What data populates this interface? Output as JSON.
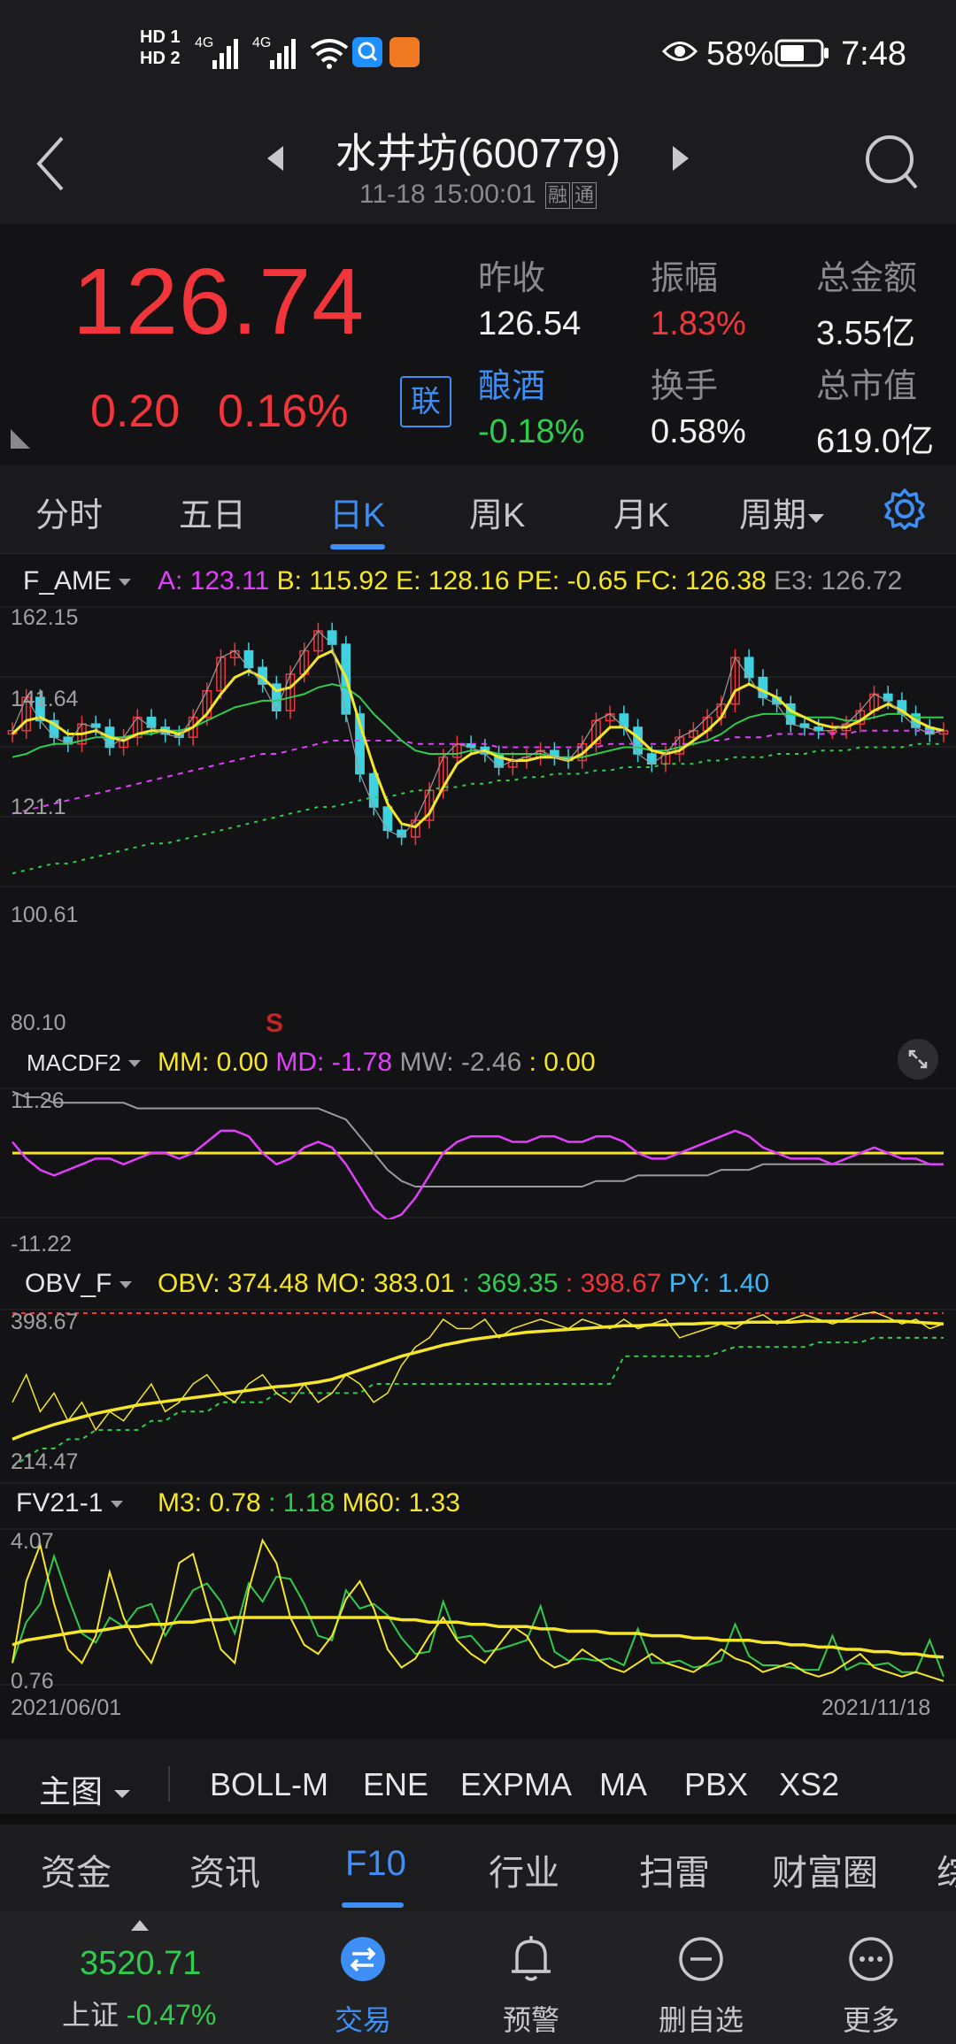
{
  "status_bar": {
    "time": "7:48",
    "battery": "58%",
    "sim1": "HD 1",
    "sim2": "HD 2",
    "net1": "4G",
    "net2": "4G"
  },
  "header": {
    "title": "水井坊(600779)",
    "timestamp": "11-18 15:00:01",
    "badge1": "融",
    "badge2": "通"
  },
  "quote": {
    "price": "126.74",
    "change": "0.20",
    "change_pct": "0.16%",
    "link_badge": "联",
    "fields": [
      {
        "label": "昨收",
        "value": "126.54",
        "color": "#f2f2f2"
      },
      {
        "label": "振幅",
        "value": "1.83%",
        "color": "#f2353a"
      },
      {
        "label": "总金额",
        "value": "3.55亿",
        "color": "#f2f2f2"
      },
      {
        "label": "酿酒",
        "value": "-0.18%",
        "color": "#2fcc4d"
      },
      {
        "label": "换手",
        "value": "0.58%",
        "color": "#f2f2f2"
      },
      {
        "label": "总市值",
        "value": "619.0亿",
        "color": "#f2f2f2"
      }
    ]
  },
  "tabs": {
    "items": [
      "分时",
      "五日",
      "日K",
      "周K",
      "月K",
      "周期"
    ],
    "active": "日K"
  },
  "chart_data": [
    {
      "type": "line",
      "name": "F_AME",
      "legend": [
        "A: 123.11",
        "B: 115.92",
        "E: 128.16",
        "PE: -0.65",
        "FC: 126.38",
        "E3: 126.72"
      ],
      "legend_colors": [
        "#e040fb",
        "#f5e62a",
        "#f5e62a",
        "#f5e62a",
        "#f5e62a",
        "#9a9a9a"
      ],
      "y_ticks": [
        "162.15",
        "141.64",
        "121.1",
        "100.61",
        "80.10"
      ],
      "ylim": [
        80.1,
        162.15
      ],
      "marker": "S",
      "closes": [
        126,
        136,
        129,
        124,
        122,
        128,
        127,
        121,
        124,
        130,
        127,
        125,
        124,
        130,
        138,
        148,
        150,
        145,
        140,
        132,
        143,
        150,
        156,
        152,
        131,
        113,
        103,
        96,
        94,
        99,
        108,
        118,
        122,
        121,
        119,
        115,
        117,
        118,
        120,
        118,
        117,
        122,
        129,
        131,
        127,
        119,
        116,
        119,
        124,
        126,
        130,
        134,
        148,
        142,
        136,
        134,
        128,
        127,
        126,
        126,
        128,
        132,
        137,
        135,
        131,
        127,
        125,
        126
      ],
      "ma_short": [
        125,
        129,
        130,
        128,
        125,
        125,
        126,
        124,
        123,
        125,
        126,
        126,
        125,
        127,
        131,
        137,
        142,
        144,
        142,
        138,
        139,
        143,
        148,
        150,
        142,
        128,
        115,
        104,
        98,
        97,
        101,
        109,
        116,
        119,
        120,
        118,
        117,
        117,
        118,
        118,
        117,
        119,
        123,
        127,
        127,
        124,
        120,
        119,
        120,
        123,
        126,
        130,
        138,
        140,
        138,
        136,
        132,
        130,
        128,
        127,
        127,
        129,
        132,
        134,
        132,
        129,
        127,
        126
      ],
      "ma_mid": [
        118,
        119,
        121,
        122,
        122,
        123,
        124,
        124,
        124,
        125,
        125,
        126,
        126,
        127,
        129,
        131,
        133,
        134,
        135,
        135,
        136,
        137,
        139,
        140,
        139,
        136,
        131,
        127,
        123,
        120,
        119,
        119,
        119,
        120,
        120,
        119,
        119,
        119,
        119,
        118,
        118,
        118,
        119,
        120,
        121,
        121,
        120,
        120,
        121,
        122,
        123,
        125,
        128,
        130,
        131,
        131,
        131,
        130,
        130,
        130,
        129,
        129,
        130,
        131,
        131,
        130,
        130,
        130
      ],
      "ma_long1": [
        101,
        102,
        103,
        104,
        105,
        106,
        107,
        108,
        109,
        110,
        111,
        112,
        113,
        114,
        115,
        116,
        117,
        118,
        119,
        119,
        120,
        121,
        122,
        123,
        123,
        123,
        123,
        123,
        123,
        122,
        122,
        122,
        122,
        122,
        122,
        121,
        121,
        121,
        121,
        121,
        121,
        121,
        121,
        122,
        122,
        122,
        122,
        122,
        122,
        122,
        123,
        123,
        124,
        124,
        124,
        125,
        125,
        125,
        125,
        125,
        125,
        126,
        126,
        126,
        126,
        126,
        126,
        126
      ],
      "ma_long2": [
        83,
        84,
        85,
        86,
        86,
        87,
        88,
        89,
        90,
        91,
        92,
        92,
        93,
        94,
        95,
        96,
        97,
        98,
        99,
        100,
        101,
        102,
        103,
        103,
        104,
        105,
        106,
        106,
        107,
        108,
        108,
        109,
        109,
        110,
        110,
        111,
        111,
        112,
        112,
        113,
        113,
        113,
        114,
        114,
        115,
        115,
        115,
        116,
        116,
        116,
        117,
        117,
        118,
        118,
        118,
        119,
        119,
        119,
        120,
        120,
        120,
        121,
        121,
        121,
        121,
        122,
        122,
        122
      ]
    },
    {
      "type": "line",
      "name": "MACDF2",
      "legend": [
        "MM: 0.00",
        "MD: -1.78",
        "MW: -2.46",
        ": 0.00"
      ],
      "legend_colors": [
        "#f5e62a",
        "#e040fb",
        "#9a9a9a",
        "#f5e62a"
      ],
      "y_ticks": [
        "11.26",
        "-11.22"
      ],
      "ylim": [
        -11.22,
        11.26
      ],
      "mm": 0.0,
      "md": [
        2,
        -1,
        -3,
        -4,
        -3,
        -2,
        -1,
        -1,
        -2,
        -1,
        0,
        0,
        -1,
        0,
        2,
        4,
        4,
        3,
        0,
        -2,
        -1,
        1,
        2,
        1,
        -2,
        -6,
        -10,
        -12,
        -11,
        -8,
        -4,
        0,
        2,
        3,
        3,
        3,
        2,
        2,
        3,
        3,
        2,
        2,
        3,
        3,
        2,
        0,
        -1,
        -1,
        0,
        1,
        2,
        3,
        4,
        3,
        1,
        0,
        -1,
        -1,
        -1,
        -2,
        -1,
        0,
        1,
        0,
        -1,
        -1,
        -2,
        -2
      ],
      "mw": [
        11,
        10,
        10,
        9,
        9,
        9,
        9,
        9,
        9,
        8,
        8,
        8,
        8,
        8,
        8,
        8,
        8,
        8,
        8,
        8,
        8,
        8,
        8,
        7,
        6,
        3,
        0,
        -3,
        -5,
        -6,
        -6,
        -6,
        -6,
        -6,
        -6,
        -6,
        -6,
        -6,
        -6,
        -6,
        -6,
        -6,
        -5,
        -5,
        -5,
        -4,
        -4,
        -4,
        -4,
        -4,
        -4,
        -3,
        -3,
        -3,
        -2,
        -2,
        -2,
        -2,
        -2,
        -2,
        -2,
        -2,
        -2,
        -2,
        -2,
        -2,
        -2,
        -2
      ]
    },
    {
      "type": "line",
      "name": "OBV_F",
      "legend": [
        "OBV: 374.48",
        "MO: 383.01",
        ": 369.35",
        ": 398.67",
        "PY: 1.40"
      ],
      "legend_colors": [
        "#f5e62a",
        "#f5e62a",
        "#2fcc4d",
        "#f2353a",
        "#3fb6f5"
      ],
      "y_ticks": [
        "398.67",
        "214.47"
      ],
      "ylim": [
        214.47,
        398.67
      ],
      "obv": [
        300,
        330,
        290,
        310,
        280,
        300,
        270,
        290,
        280,
        300,
        320,
        290,
        300,
        320,
        330,
        310,
        300,
        320,
        330,
        310,
        300,
        320,
        300,
        310,
        330,
        320,
        300,
        310,
        340,
        360,
        370,
        390,
        380,
        380,
        390,
        370,
        380,
        385,
        390,
        385,
        380,
        390,
        385,
        380,
        390,
        380,
        385,
        390,
        370,
        375,
        380,
        385,
        380,
        390,
        395,
        385,
        390,
        395,
        390,
        385,
        390,
        395,
        398,
        392,
        385,
        390,
        380,
        385
      ],
      "mo": [
        260,
        266,
        271,
        276,
        280,
        284,
        288,
        291,
        294,
        297,
        299,
        301,
        303,
        305,
        307,
        309,
        311,
        313,
        315,
        317,
        318,
        320,
        322,
        325,
        330,
        335,
        340,
        345,
        350,
        354,
        358,
        362,
        365,
        368,
        370,
        372,
        374,
        376,
        377,
        378,
        379,
        380,
        381,
        382,
        383,
        383,
        384,
        384,
        385,
        385,
        386,
        386,
        386,
        387,
        387,
        387,
        387,
        388,
        388,
        388,
        388,
        388,
        388,
        388,
        388,
        387,
        386,
        385
      ],
      "lo": [
        230,
        240,
        250,
        250,
        260,
        260,
        270,
        270,
        270,
        270,
        280,
        280,
        290,
        290,
        290,
        300,
        300,
        300,
        300,
        310,
        310,
        310,
        310,
        310,
        310,
        310,
        320,
        320,
        320,
        320,
        320,
        320,
        320,
        320,
        320,
        320,
        320,
        320,
        320,
        320,
        320,
        320,
        320,
        320,
        350,
        350,
        350,
        350,
        350,
        350,
        350,
        355,
        360,
        360,
        360,
        360,
        360,
        360,
        365,
        365,
        365,
        365,
        370,
        370,
        370,
        370,
        370,
        370
      ],
      "hi": 398.67
    },
    {
      "type": "line",
      "name": "FV21-1",
      "legend": [
        "M3: 0.78",
        ": 1.18",
        "M60: 1.33"
      ],
      "legend_colors": [
        "#f5e62a",
        "#2fcc4d",
        "#f5e62a"
      ],
      "y_ticks": [
        "4.07",
        "0.76"
      ],
      "ylim": [
        0.76,
        4.07
      ],
      "x_ticks": [
        "2021/06/01",
        "2021/11/18"
      ],
      "m3": [
        1.2,
        3.0,
        3.8,
        2.5,
        1.5,
        1.2,
        1.8,
        3.2,
        2.2,
        1.6,
        1.2,
        2.0,
        3.4,
        3.6,
        2.5,
        1.5,
        1.2,
        2.8,
        3.9,
        3.4,
        2.2,
        1.6,
        1.4,
        1.8,
        2.6,
        3.0,
        2.4,
        1.5,
        1.1,
        1.3,
        1.8,
        2.2,
        1.7,
        1.4,
        1.2,
        1.6,
        2.0,
        1.8,
        1.3,
        1.1,
        1.2,
        1.5,
        1.3,
        1.1,
        1.0,
        1.2,
        1.4,
        1.2,
        1.1,
        1.0,
        1.2,
        1.5,
        1.3,
        1.2,
        1.0,
        1.1,
        1.2,
        1.0,
        0.9,
        1.0,
        1.2,
        1.4,
        1.1,
        1.0,
        0.9,
        1.0,
        0.9,
        0.8
      ],
      "m60": [
        1.6,
        1.7,
        1.75,
        1.8,
        1.85,
        1.9,
        1.9,
        1.95,
        2.0,
        2.0,
        2.05,
        2.05,
        2.1,
        2.1,
        2.15,
        2.15,
        2.2,
        2.2,
        2.2,
        2.2,
        2.2,
        2.2,
        2.2,
        2.2,
        2.2,
        2.2,
        2.2,
        2.2,
        2.15,
        2.15,
        2.1,
        2.1,
        2.1,
        2.05,
        2.05,
        2.0,
        2.0,
        2.0,
        1.95,
        1.95,
        1.9,
        1.9,
        1.9,
        1.85,
        1.85,
        1.85,
        1.8,
        1.8,
        1.8,
        1.75,
        1.75,
        1.7,
        1.7,
        1.7,
        1.65,
        1.65,
        1.6,
        1.6,
        1.55,
        1.55,
        1.5,
        1.5,
        1.45,
        1.45,
        1.4,
        1.4,
        1.35,
        1.33
      ]
    }
  ],
  "indicator_bar": {
    "main_label": "主图",
    "items": [
      "BOLL-M",
      "ENE",
      "EXPMA",
      "MA",
      "PBX",
      "XS2"
    ]
  },
  "f10_tabs": {
    "items": [
      "资金",
      "资讯",
      "F10",
      "行业",
      "扫雷",
      "财富圈",
      "综"
    ],
    "active": "F10"
  },
  "bottom_nav": {
    "index_value": "3520.71",
    "index_name": "上证",
    "index_change": "-0.47%",
    "items": [
      "交易",
      "预警",
      "删自选",
      "更多"
    ]
  }
}
